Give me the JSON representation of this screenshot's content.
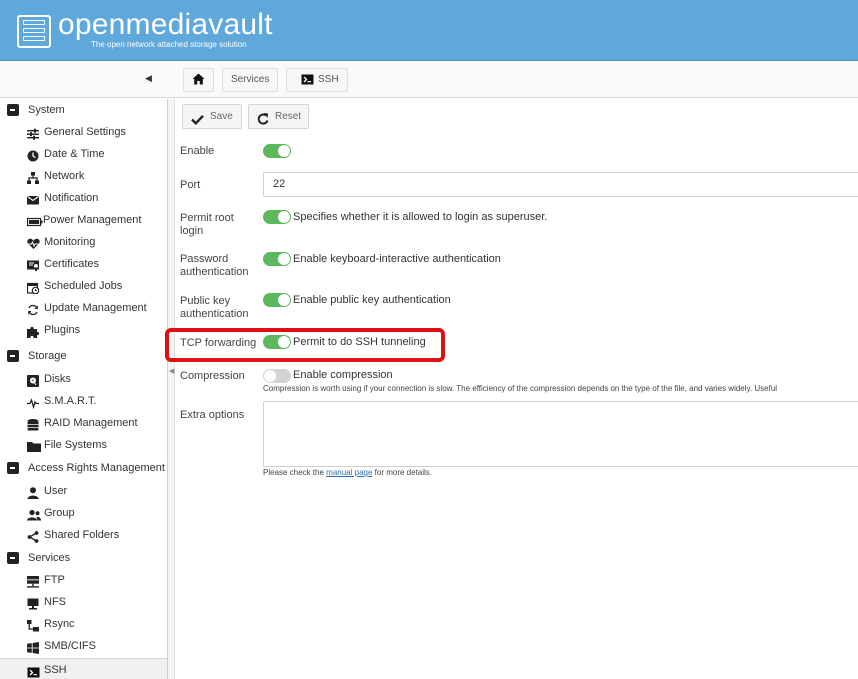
{
  "app": {
    "title": "openmediavault",
    "subtitle": "The open network attached storage solution"
  },
  "breadcrumb": {
    "home_icon": "home-icon",
    "items": [
      "Services",
      "SSH"
    ]
  },
  "sidebar": {
    "collapse_icon": "chevron-left-icon",
    "items": [
      {
        "label": "System",
        "type": "group",
        "icon": "minus-square-icon"
      },
      {
        "label": "General Settings",
        "type": "child",
        "icon": "sliders-icon"
      },
      {
        "label": "Date & Time",
        "type": "child",
        "icon": "clock-icon"
      },
      {
        "label": "Network",
        "type": "child",
        "icon": "network-icon"
      },
      {
        "label": "Notification",
        "type": "child",
        "icon": "envelope-icon"
      },
      {
        "label": "Power Management",
        "type": "child",
        "icon": "battery-icon"
      },
      {
        "label": "Monitoring",
        "type": "child",
        "icon": "heartbeat-icon"
      },
      {
        "label": "Certificates",
        "type": "child",
        "icon": "certificate-icon"
      },
      {
        "label": "Scheduled Jobs",
        "type": "child",
        "icon": "calendar-clock-icon"
      },
      {
        "label": "Update Management",
        "type": "child",
        "icon": "refresh-icon"
      },
      {
        "label": "Plugins",
        "type": "child",
        "icon": "puzzle-icon"
      },
      {
        "label": "Storage",
        "type": "group",
        "icon": "minus-square-icon"
      },
      {
        "label": "Disks",
        "type": "child",
        "icon": "disk-icon"
      },
      {
        "label": "S.M.A.R.T.",
        "type": "child",
        "icon": "pulse-icon"
      },
      {
        "label": "RAID Management",
        "type": "child",
        "icon": "database-icon"
      },
      {
        "label": "File Systems",
        "type": "child",
        "icon": "folder-icon"
      },
      {
        "label": "Access Rights Management",
        "type": "group",
        "icon": "minus-square-icon"
      },
      {
        "label": "User",
        "type": "child",
        "icon": "user-icon"
      },
      {
        "label": "Group",
        "type": "child",
        "icon": "users-icon"
      },
      {
        "label": "Shared Folders",
        "type": "child",
        "icon": "share-icon"
      },
      {
        "label": "Services",
        "type": "group",
        "icon": "minus-square-icon"
      },
      {
        "label": "FTP",
        "type": "child",
        "icon": "server-icon"
      },
      {
        "label": "NFS",
        "type": "child",
        "icon": "desktop-icon"
      },
      {
        "label": "Rsync",
        "type": "child",
        "icon": "sitemap-icon"
      },
      {
        "label": "SMB/CIFS",
        "type": "child",
        "icon": "windows-icon"
      },
      {
        "label": "SSH",
        "type": "child",
        "icon": "terminal-icon",
        "active": true
      }
    ]
  },
  "toolbar": {
    "save_label": "Save",
    "reset_label": "Reset"
  },
  "form": {
    "enable": {
      "label": "Enable",
      "value": true
    },
    "port": {
      "label": "Port",
      "value": "22"
    },
    "permit_root": {
      "label": "Permit root login",
      "value": true,
      "text": "Specifies whether it is allowed to login as superuser."
    },
    "password_auth": {
      "label": "Password authentication",
      "value": true,
      "text": "Enable keyboard-interactive authentication"
    },
    "pubkey_auth": {
      "label": "Public key authentication",
      "value": true,
      "text": "Enable public key authentication"
    },
    "tcp_forwarding": {
      "label": "TCP forwarding",
      "value": true,
      "text": "Permit to do SSH tunneling"
    },
    "compression": {
      "label": "Compression",
      "value": false,
      "text": "Enable compression",
      "hint": "Compression is worth using if your connection is slow. The efficiency of the compression depends on the type of the file, and varies widely. Useful"
    },
    "extra_options": {
      "label": "Extra options",
      "value": "",
      "hint_before": "Please check the ",
      "hint_link": "manual page",
      "hint_after": " for more details."
    }
  },
  "colors": {
    "header": "#5ea8dc",
    "toggle_on": "#5cb85c",
    "highlight": "#e01010"
  }
}
